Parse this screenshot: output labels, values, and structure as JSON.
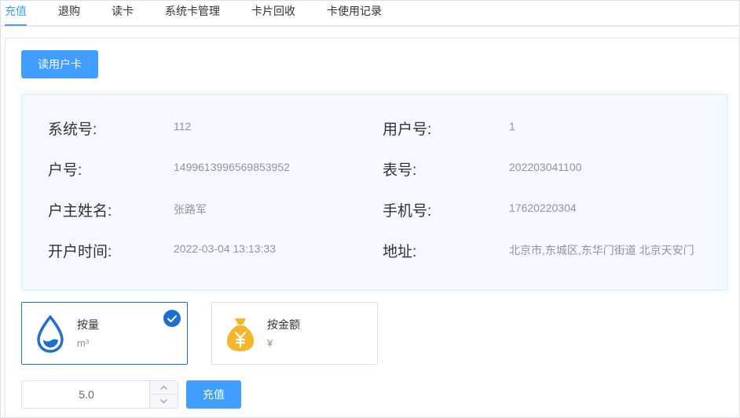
{
  "tabs": [
    {
      "label": "充值"
    },
    {
      "label": "退购"
    },
    {
      "label": "读卡"
    },
    {
      "label": "系统卡管理"
    },
    {
      "label": "卡片回收"
    },
    {
      "label": "卡使用记录"
    }
  ],
  "read_card_button": "读用户卡",
  "info": {
    "system_no_label": "系统号:",
    "system_no": "112",
    "user_no_label": "用户号:",
    "user_no": "1",
    "account_label": "户号:",
    "account": "1499613996569853952",
    "meter_label": "表号:",
    "meter": "202203041100",
    "owner_label": "户主姓名:",
    "owner": "张路军",
    "phone_label": "手机号:",
    "phone": "17620220304",
    "open_time_label": "开户时间:",
    "open_time": "2022-03-04 13:13:33",
    "address_label": "地址:",
    "address": "北京市,东城区,东华门街道 北京天安门"
  },
  "options": {
    "by_volume": {
      "title": "按量",
      "unit": "m³",
      "selected": true,
      "icon": "water-drop-icon"
    },
    "by_amount": {
      "title": "按金额",
      "unit": "¥",
      "selected": false,
      "icon": "money-bag-icon"
    }
  },
  "amount_input": {
    "value": "5.0"
  },
  "recharge_button": "充值",
  "colors": {
    "primary": "#409eff",
    "selected_border": "#1f6fd1",
    "drop": "#1f6fd1",
    "bag": "#f5b62b"
  }
}
